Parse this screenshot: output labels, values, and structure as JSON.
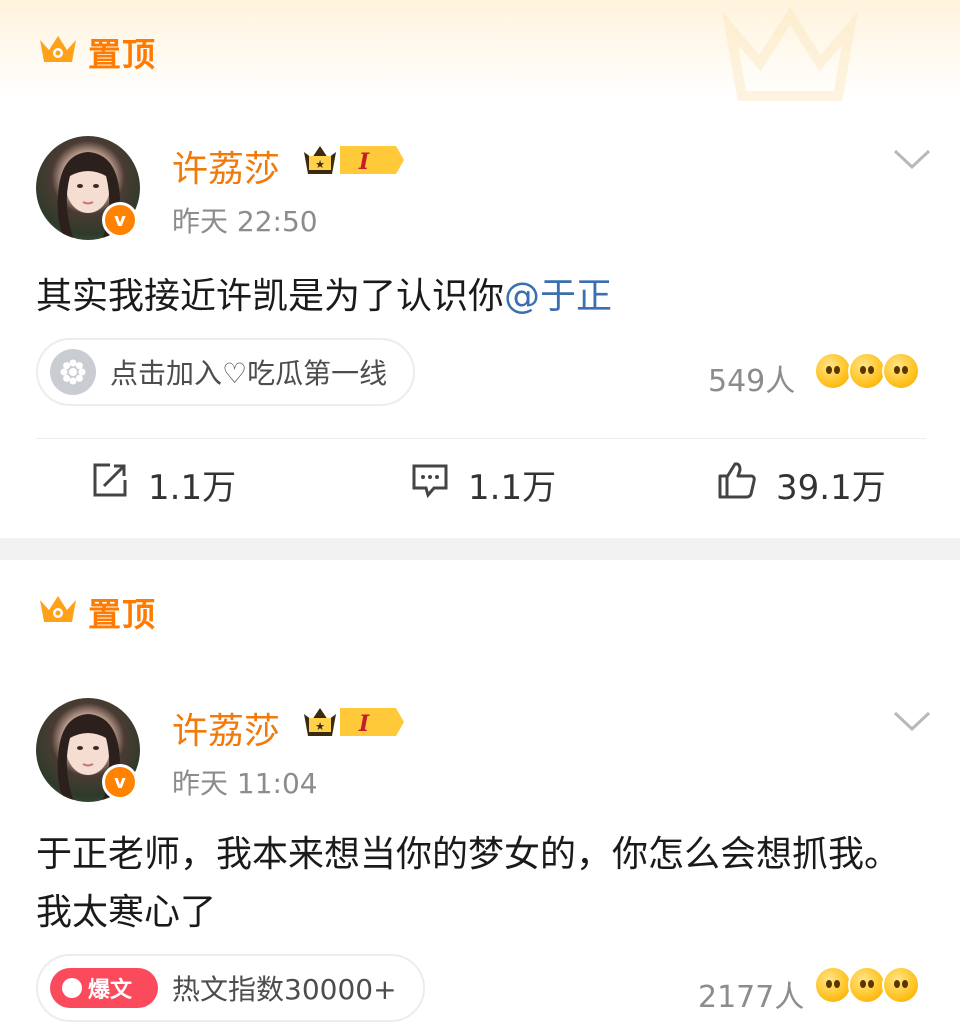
{
  "posts": [
    {
      "pin_label": "置顶",
      "author": "许荔莎",
      "level": "I",
      "verified_mark": "v",
      "time": "昨天 22:50",
      "content_text": "其实我接近许凯是为了认识你",
      "mention": "@于正",
      "chip": {
        "icon": "kiwi-slice-icon",
        "text": "点击加入♡吃瓜第一线"
      },
      "reaction_count": "549人",
      "actions": {
        "repost": "1.1万",
        "comment": "1.1万",
        "like": "39.1万"
      }
    },
    {
      "pin_label": "置顶",
      "author": "许荔莎",
      "level": "I",
      "verified_mark": "v",
      "time": "昨天 11:04",
      "content_text": "于正老师，我本来想当你的梦女的，你怎么会想抓我。我太寒心了",
      "chip": {
        "badge": "爆文",
        "text": "热文指数30000+"
      },
      "reaction_count": "2177人"
    }
  ],
  "colors": {
    "accent": "#ff7a00",
    "name": "#f07a0a",
    "mention": "#3a6fb0",
    "badge_red": "#fb4a5c"
  }
}
